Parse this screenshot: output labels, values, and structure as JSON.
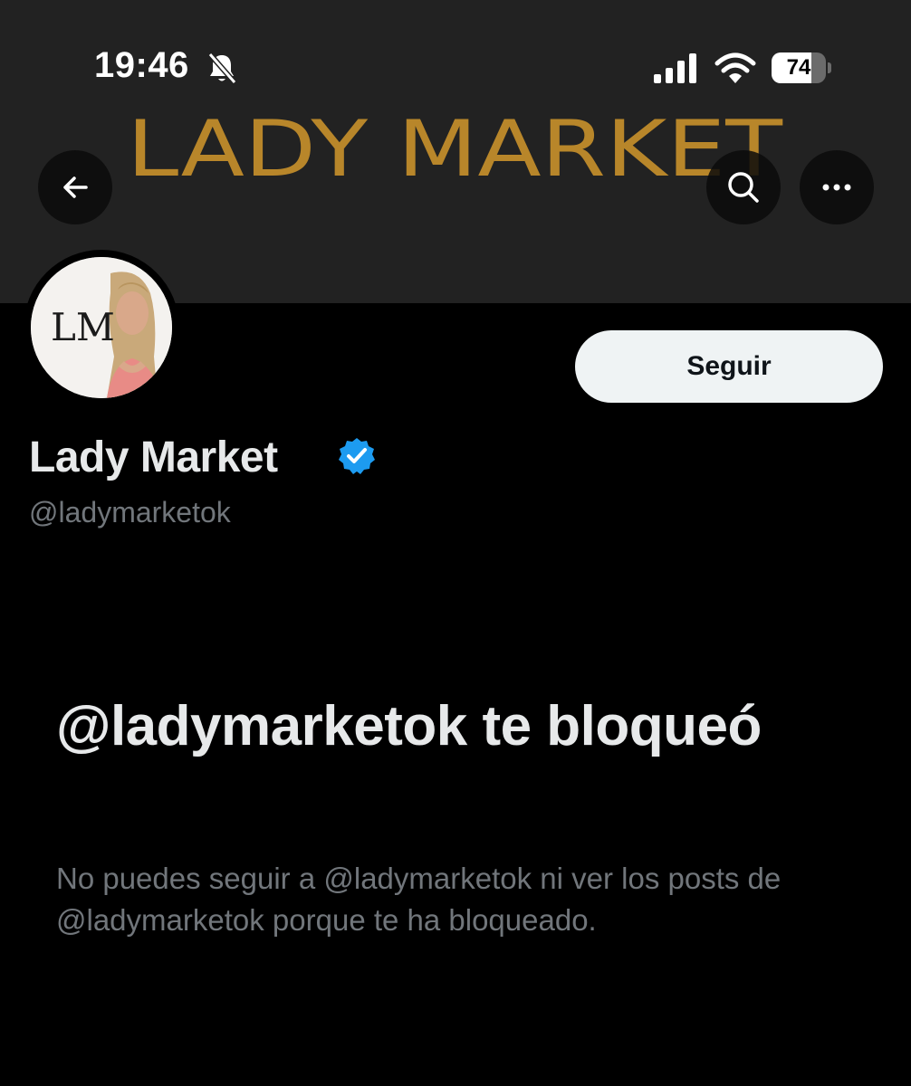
{
  "status_bar": {
    "time": "19:46",
    "battery_percent": "74",
    "battery_level": 0.74,
    "icons": [
      "bell-slash-icon",
      "signal-icon",
      "wifi-icon",
      "battery-icon"
    ]
  },
  "banner": {
    "logo_text": "LADY MARKET",
    "logo_color": "#b8862a",
    "background": "#222222"
  },
  "nav": {
    "back_icon": "arrow-left-icon",
    "search_icon": "search-icon",
    "more_icon": "more-horizontal-icon"
  },
  "avatar": {
    "monogram": "LM"
  },
  "follow_button": {
    "label": "Seguir"
  },
  "profile": {
    "name": "Lady Market",
    "handle": "@ladymarketok",
    "verified": true,
    "verified_color": "#1d9bf0"
  },
  "blocked_notice": {
    "title": "@ladymarketok te bloqueó",
    "description": "No puedes seguir a @ladymarketok ni ver los posts de @ladymarketok porque te ha bloqueado."
  }
}
